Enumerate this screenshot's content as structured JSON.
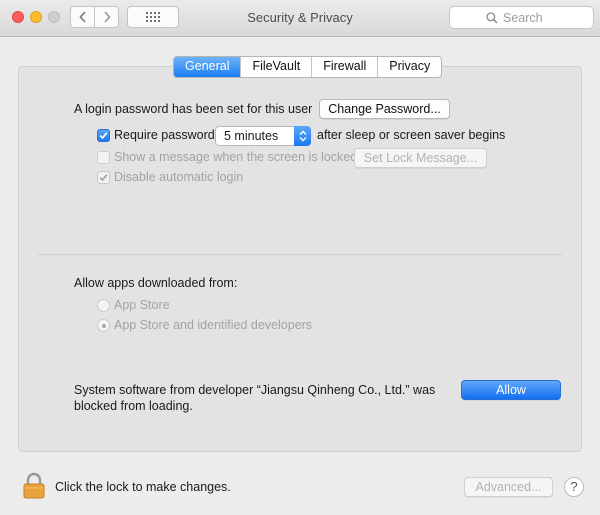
{
  "window": {
    "title": "Security & Privacy"
  },
  "search": {
    "placeholder": "Search"
  },
  "tabs": [
    "General",
    "FileVault",
    "Firewall",
    "Privacy"
  ],
  "general": {
    "login_text": "A login password has been set for this user",
    "change_password_label": "Change Password...",
    "require_password_label": "Require password",
    "require_password_checked": true,
    "require_password_delay": "5 minutes",
    "after_sleep_text": "after sleep or screen saver begins",
    "show_message_label": "Show a message when the screen is locked",
    "show_message_checked": false,
    "set_lock_message_label": "Set Lock Message...",
    "disable_auto_login_label": "Disable automatic login",
    "disable_auto_login_checked": true
  },
  "apps": {
    "heading": "Allow apps downloaded from:",
    "options": [
      "App Store",
      "App Store and identified developers"
    ],
    "selected": "App Store and identified developers"
  },
  "blocked": {
    "line1": "System software from developer “Jiangsu Qinheng Co., Ltd.” was",
    "line2": "blocked from loading.",
    "allow_label": "Allow"
  },
  "footer": {
    "lock_text": "Click the lock to make changes.",
    "advanced_label": "Advanced...",
    "help_label": "?"
  },
  "colors": {
    "accent": "#1b7df3",
    "tab_active_text": "#ffffff"
  }
}
